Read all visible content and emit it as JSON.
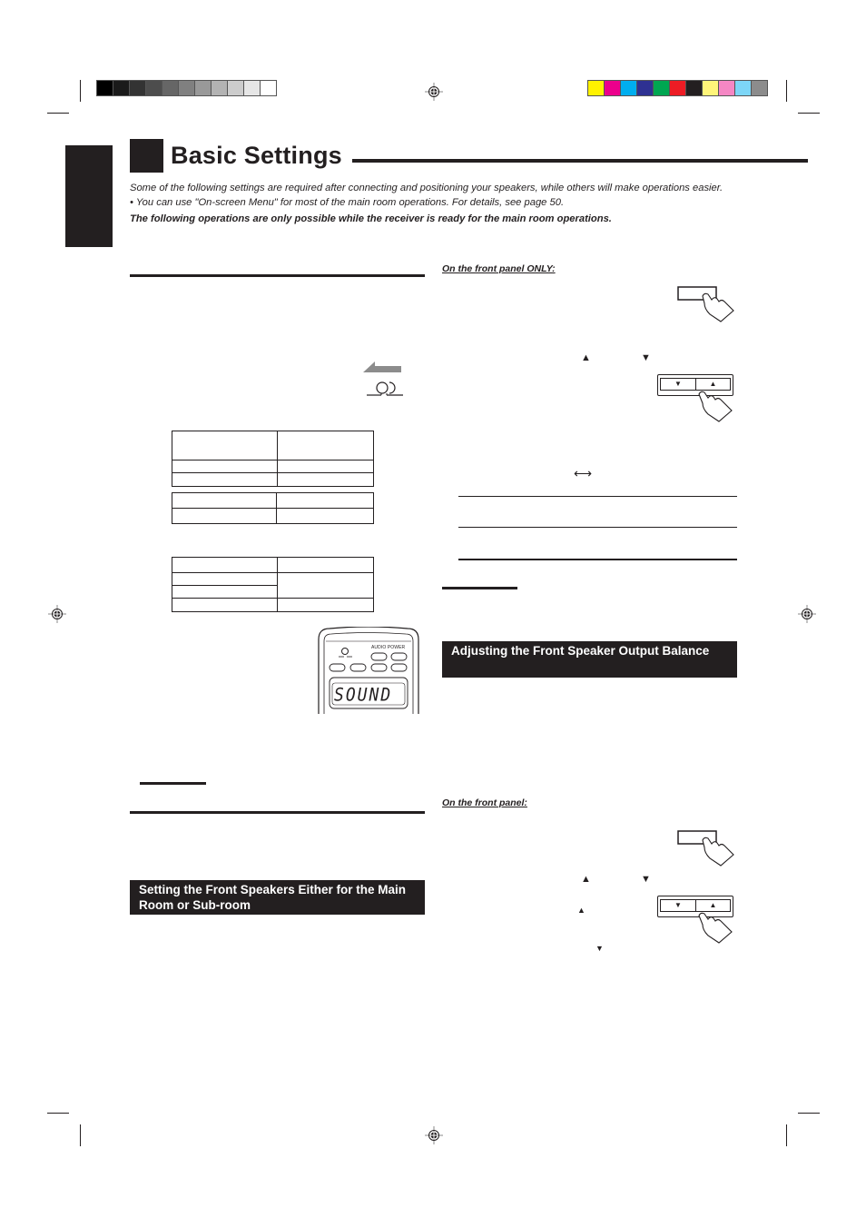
{
  "header": {
    "title": "Basic Settings",
    "intro_text": "Some of the following settings are required after connecting and positioning your speakers, while others will make operations easier.",
    "bullet": "•   You can use \"On-screen Menu\" for most of the main room operations. For details, see page 50.",
    "bold_note": "The following operations are only possible while the receiver is ready for the main room operations."
  },
  "colors": {
    "grayscale_swatches": [
      "#000000",
      "#1a1a1a",
      "#333333",
      "#4d4d4d",
      "#666666",
      "#808080",
      "#999999",
      "#b3b3b3",
      "#cccccc",
      "#e6e6e6",
      "#ffffff"
    ],
    "process_swatches": [
      "#fff200",
      "#ec008c",
      "#00aeef",
      "#2e3192",
      "#00a651",
      "#ed1c24",
      "#231f20",
      "#fff57a",
      "#f587c4",
      "#7dd6f7",
      "#8c8c8c"
    ],
    "ink": "#231f20"
  },
  "right_column": {
    "front_panel_only_label": "On the front panel ONLY:",
    "front_panel_label": "On the front panel:",
    "section_heading_balance": "Adjusting the Front Speaker Output Balance",
    "up_arrow": "▲",
    "down_arrow": "▼",
    "double_arrow": "⟷"
  },
  "left_column": {
    "section_heading_front_speakers": "Setting the Front Speakers Either for the Main Room or Sub-room"
  },
  "remote": {
    "audio_power_label": "AUDIO POWER",
    "display_text": "SOUND"
  },
  "panel_buttons": {
    "down_label": "▼",
    "up_label": "▲"
  }
}
